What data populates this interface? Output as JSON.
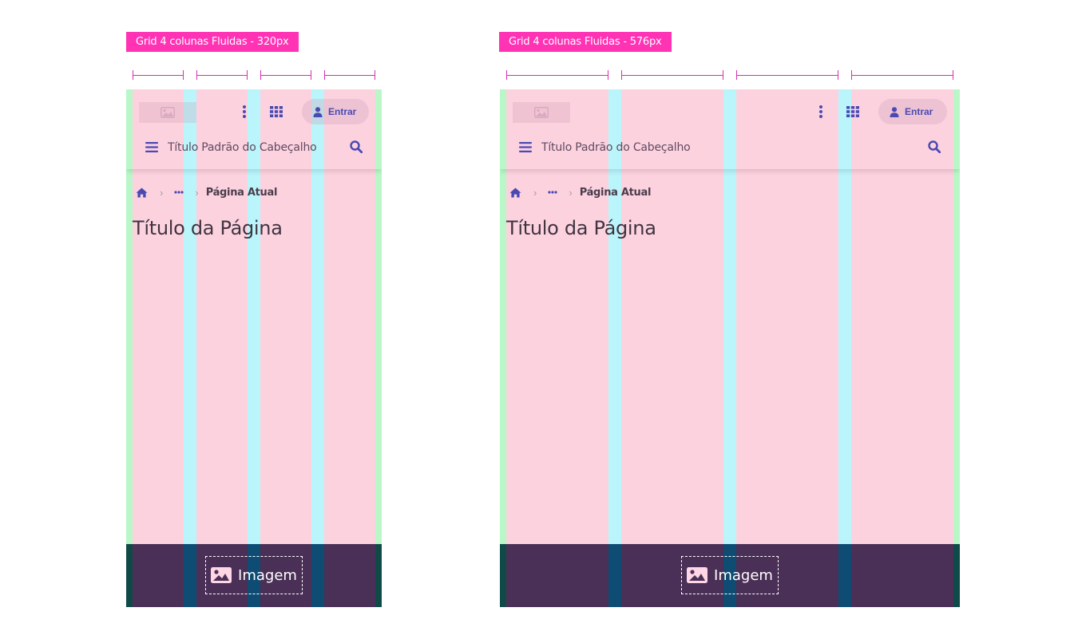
{
  "panels": [
    {
      "tag": "Grid 4 colunas Fluidas - 320px",
      "header": {
        "login_label": "Entrar",
        "title": "Título Padrão do Cabeçalho"
      },
      "breadcrumb": {
        "current": "Página Atual"
      },
      "page_title": "Título da Página",
      "footer": {
        "image_label": "Imagem"
      }
    },
    {
      "tag": "Grid 4 colunas Fluidas - 576px",
      "header": {
        "login_label": "Entrar",
        "title": "Título Padrão do Cabeçalho"
      },
      "breadcrumb": {
        "current": "Página Atual"
      },
      "page_title": "Título da Página",
      "footer": {
        "image_label": "Imagem"
      }
    }
  ],
  "icons": {
    "image": "image-icon",
    "more": "kebab-menu-icon",
    "apps": "grid-apps-icon",
    "user": "user-icon",
    "menu": "hamburger-menu-icon",
    "search": "search-icon",
    "home": "home-icon",
    "ellipsis": "ellipsis-icon",
    "chevron": "chevron-right-icon"
  },
  "colors": {
    "tag_bg": "#ff33b4",
    "column": "#fdd2df",
    "margin": "#b9f7c9",
    "gutter": "#baf5fb",
    "primary": "#4a4ab2",
    "footer": "#4a2f56"
  }
}
